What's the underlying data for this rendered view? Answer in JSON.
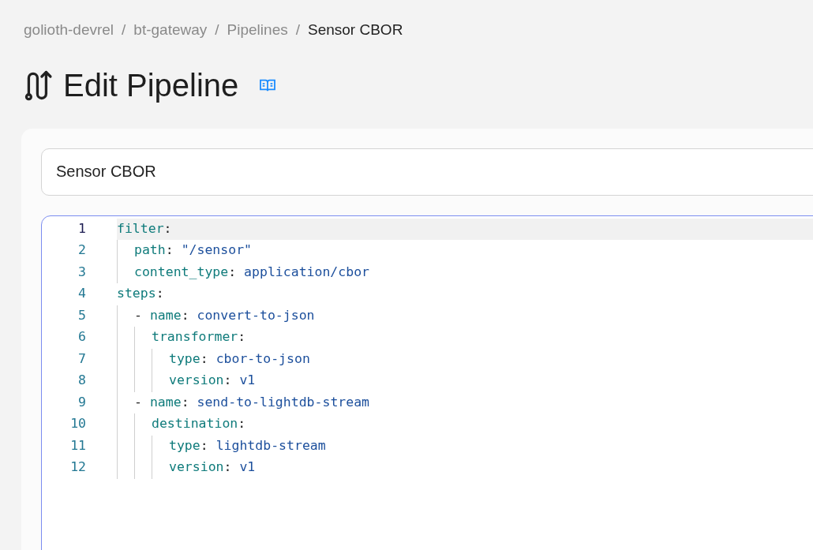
{
  "breadcrumb": [
    {
      "label": "golioth-devrel",
      "current": false
    },
    {
      "label": "bt-gateway",
      "current": false
    },
    {
      "label": "Pipelines",
      "current": false
    },
    {
      "label": "Sensor CBOR",
      "current": true
    }
  ],
  "separator": "/",
  "title": "Edit Pipeline",
  "name_field": {
    "value": "Sensor CBOR"
  },
  "editor": {
    "lines": [
      {
        "number": "1",
        "active": true,
        "tokens": [
          {
            "kind": "key",
            "text": "filter"
          },
          {
            "kind": "punct",
            "text": ":"
          }
        ],
        "children": [
          {
            "number": "2",
            "active": false,
            "tokens": [
              {
                "kind": "key",
                "text": "path"
              },
              {
                "kind": "punct",
                "text": ": "
              },
              {
                "kind": "value",
                "text": "\"/sensor\""
              }
            ]
          },
          {
            "number": "3",
            "active": false,
            "tokens": [
              {
                "kind": "key",
                "text": "content_type"
              },
              {
                "kind": "punct",
                "text": ": "
              },
              {
                "kind": "value",
                "text": "application/cbor"
              }
            ]
          }
        ]
      },
      {
        "number": "4",
        "active": false,
        "tokens": [
          {
            "kind": "key",
            "text": "steps"
          },
          {
            "kind": "punct",
            "text": ":"
          }
        ],
        "children": [
          {
            "number": "5",
            "active": false,
            "tokens": [
              {
                "kind": "punct",
                "text": "- "
              },
              {
                "kind": "key",
                "text": "name"
              },
              {
                "kind": "punct",
                "text": ": "
              },
              {
                "kind": "value",
                "text": "convert-to-json"
              }
            ],
            "children": [
              {
                "number": "6",
                "active": false,
                "tokens": [
                  {
                    "kind": "key",
                    "text": "transformer"
                  },
                  {
                    "kind": "punct",
                    "text": ":"
                  }
                ],
                "children": [
                  {
                    "number": "7",
                    "active": false,
                    "tokens": [
                      {
                        "kind": "key",
                        "text": "type"
                      },
                      {
                        "kind": "punct",
                        "text": ": "
                      },
                      {
                        "kind": "value",
                        "text": "cbor-to-json"
                      }
                    ]
                  },
                  {
                    "number": "8",
                    "active": false,
                    "tokens": [
                      {
                        "kind": "key",
                        "text": "version"
                      },
                      {
                        "kind": "punct",
                        "text": ": "
                      },
                      {
                        "kind": "value",
                        "text": "v1"
                      }
                    ]
                  }
                ]
              }
            ]
          },
          {
            "number": "9",
            "active": false,
            "tokens": [
              {
                "kind": "punct",
                "text": "- "
              },
              {
                "kind": "key",
                "text": "name"
              },
              {
                "kind": "punct",
                "text": ": "
              },
              {
                "kind": "value",
                "text": "send-to-lightdb-stream"
              }
            ],
            "children": [
              {
                "number": "10",
                "active": false,
                "tokens": [
                  {
                    "kind": "key",
                    "text": "destination"
                  },
                  {
                    "kind": "punct",
                    "text": ":"
                  }
                ],
                "children": [
                  {
                    "number": "11",
                    "active": false,
                    "tokens": [
                      {
                        "kind": "key",
                        "text": "type"
                      },
                      {
                        "kind": "punct",
                        "text": ": "
                      },
                      {
                        "kind": "value",
                        "text": "lightdb-stream"
                      }
                    ]
                  },
                  {
                    "number": "12",
                    "active": false,
                    "tokens": [
                      {
                        "kind": "key",
                        "text": "version"
                      },
                      {
                        "kind": "punct",
                        "text": ": "
                      },
                      {
                        "kind": "value",
                        "text": "v1"
                      }
                    ]
                  }
                ]
              }
            ]
          }
        ]
      }
    ]
  }
}
